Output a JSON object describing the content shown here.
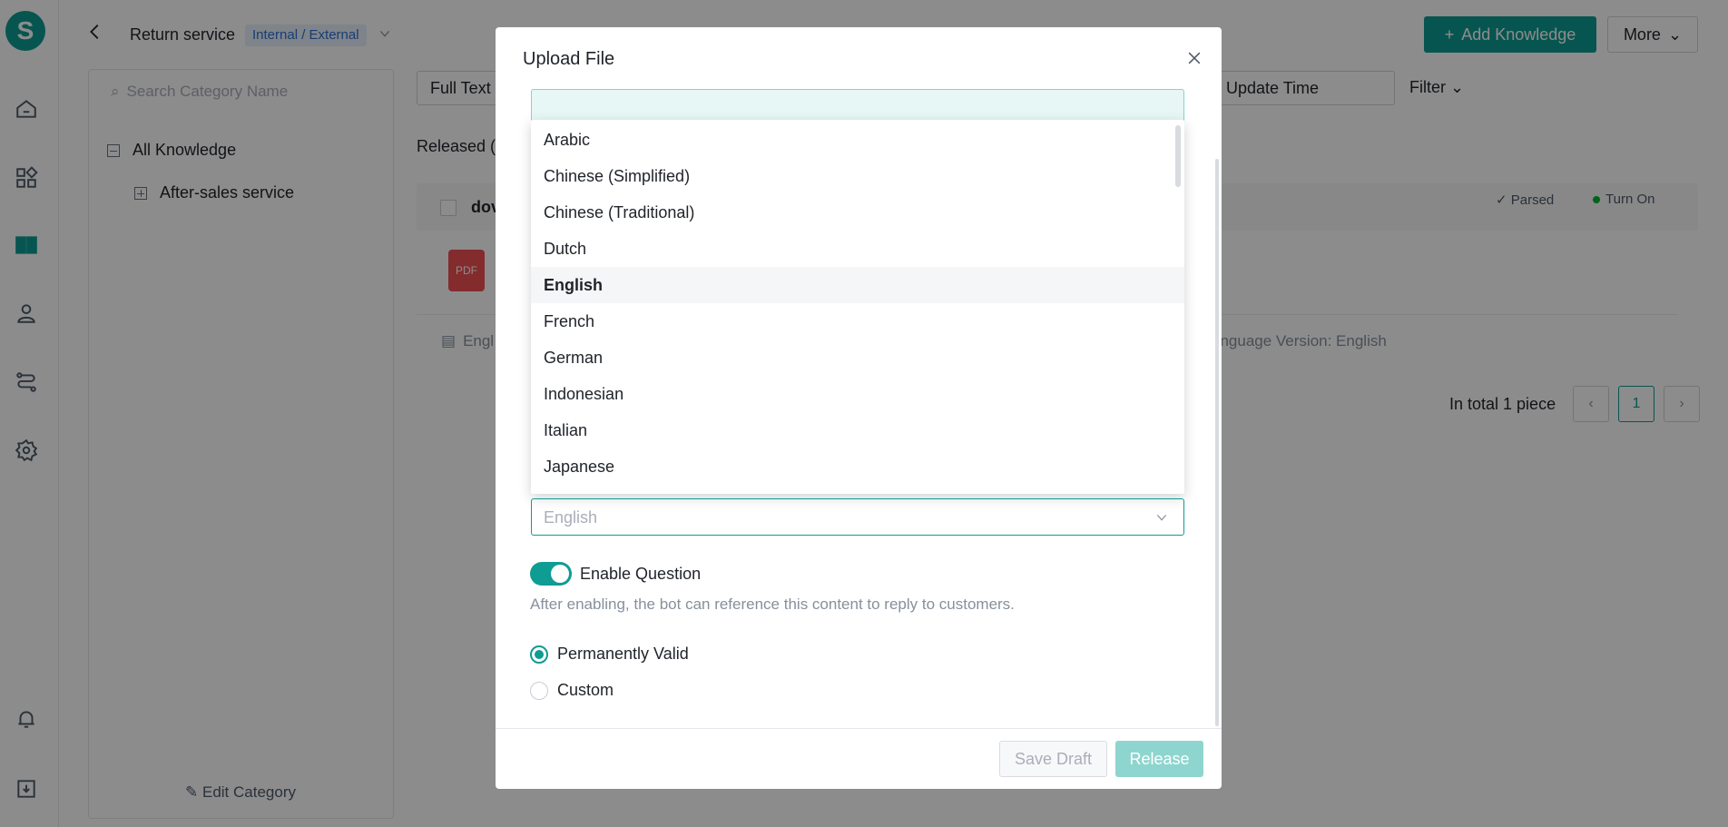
{
  "header": {
    "title": "Return service",
    "tag": "Internal / External",
    "add_label": "Add Knowledge",
    "more_label": "More"
  },
  "category": {
    "search_placeholder": "Search Category Name",
    "tree": [
      {
        "label": "All Knowledge"
      },
      {
        "label": "After-sales service"
      }
    ],
    "edit_label": "Edit Category"
  },
  "list": {
    "search_type": "Full Text",
    "sort_label": "Update Time",
    "filter_label": "Filter",
    "released_label": "Released  (",
    "first_col": "dov",
    "parsed_label": "Parsed",
    "turnon_label": "Turn On",
    "pdf_label": "PDF",
    "lang_left": "Engl",
    "lang_right": "anguage Version: English",
    "total_label": "In total 1 piece",
    "page_current": "1"
  },
  "modal": {
    "title": "Upload File",
    "languages": [
      "Arabic",
      "Chinese (Simplified)",
      "Chinese (Traditional)",
      "Dutch",
      "English",
      "French",
      "German",
      "Indonesian",
      "Italian",
      "Japanese"
    ],
    "selected_language": "English",
    "lang_select_value": "English",
    "enable_question_label": "Enable Question",
    "enable_question_on": true,
    "enable_question_desc": "After enabling, the bot can reference this content to reply to customers.",
    "validity_options": [
      "Permanently Valid",
      "Custom"
    ],
    "validity_selected": "Permanently Valid",
    "save_draft_label": "Save Draft",
    "release_label": "Release"
  },
  "colors": {
    "brand": "#0e9c93",
    "pdf": "#f04f55",
    "status_on": "#00b42a"
  }
}
